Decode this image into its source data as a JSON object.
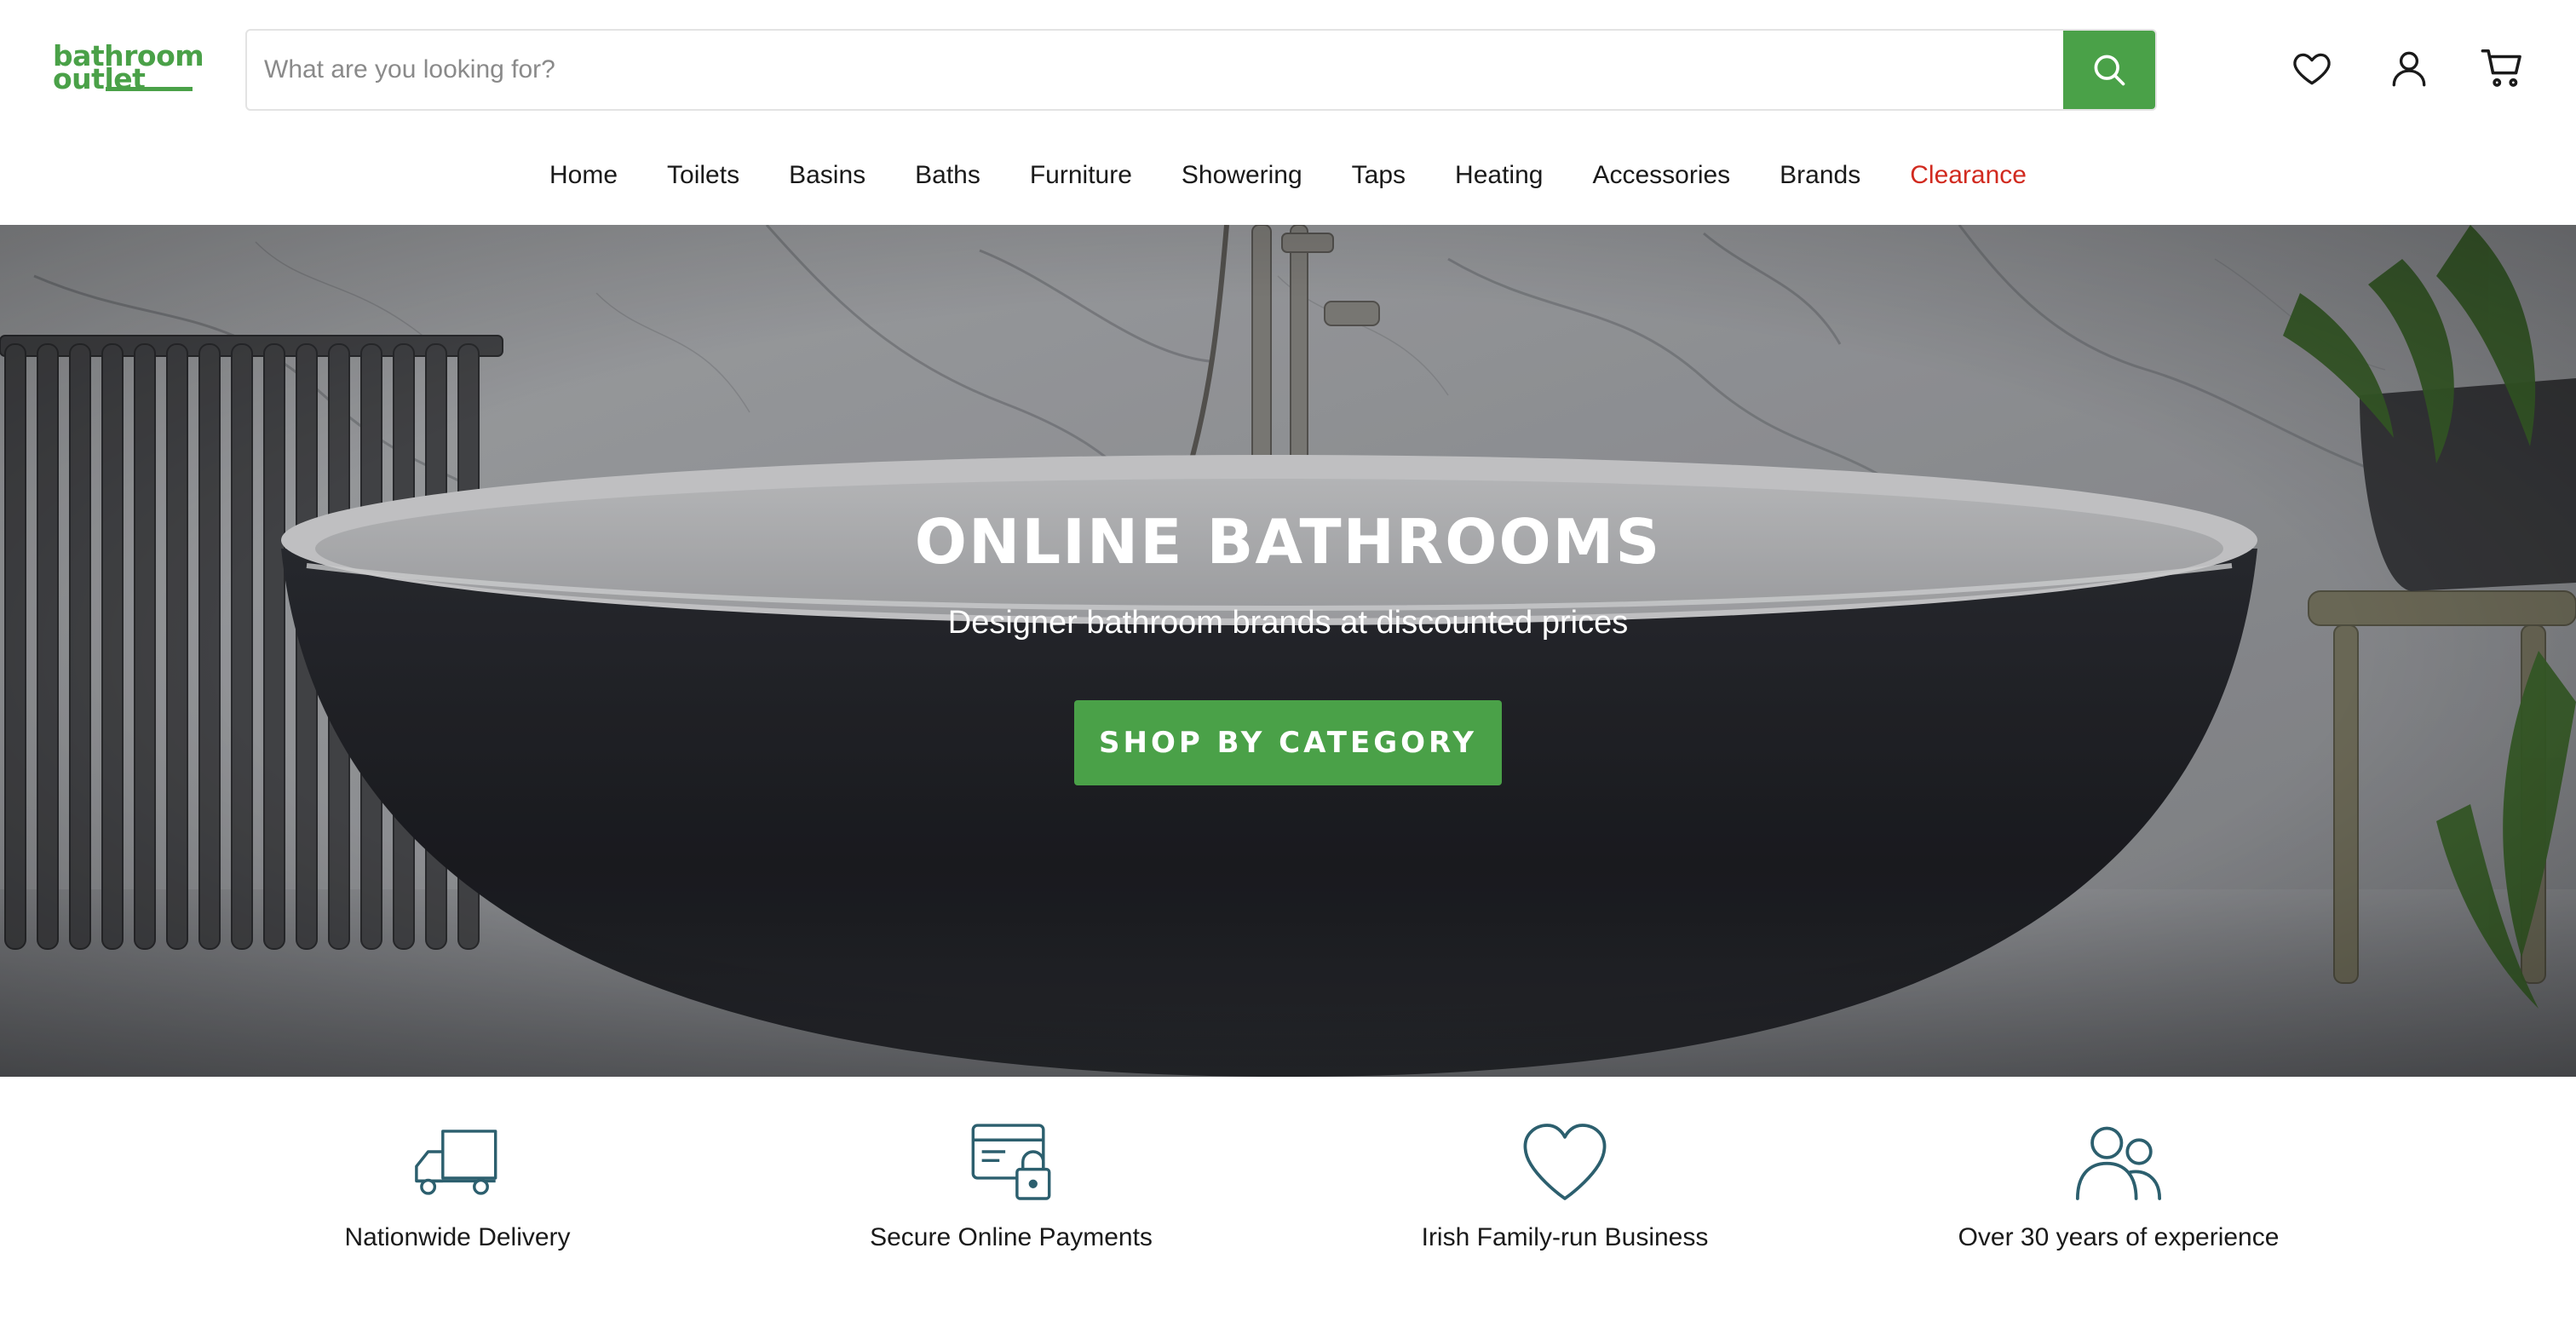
{
  "brand": {
    "logo_line1": "bathroom",
    "logo_line2": "outlet",
    "accent_color": "#4aa148",
    "clearance_color": "#d12a1f",
    "icon_color": "#2c5f6e"
  },
  "search": {
    "placeholder": "What are you looking for?",
    "button_icon": "search-icon"
  },
  "header_icons": [
    "wishlist-heart-icon",
    "account-user-icon",
    "cart-icon"
  ],
  "nav": {
    "items": [
      {
        "label": "Home"
      },
      {
        "label": "Toilets"
      },
      {
        "label": "Basins"
      },
      {
        "label": "Baths"
      },
      {
        "label": "Furniture"
      },
      {
        "label": "Showering"
      },
      {
        "label": "Taps"
      },
      {
        "label": "Heating"
      },
      {
        "label": "Accessories"
      },
      {
        "label": "Brands"
      },
      {
        "label": "Clearance"
      }
    ]
  },
  "hero": {
    "title": "ONLINE BATHROOMS",
    "subtitle": "Designer bathroom brands at discounted prices",
    "cta_label": "SHOP BY CATEGORY"
  },
  "features": [
    {
      "label": "Nationwide Delivery",
      "icon": "delivery-truck-icon"
    },
    {
      "label": "Secure Online Payments",
      "icon": "secure-card-lock-icon"
    },
    {
      "label": "Irish Family-run Business",
      "icon": "heart-icon"
    },
    {
      "label": "Over 30 years of experience",
      "icon": "people-icon"
    }
  ]
}
